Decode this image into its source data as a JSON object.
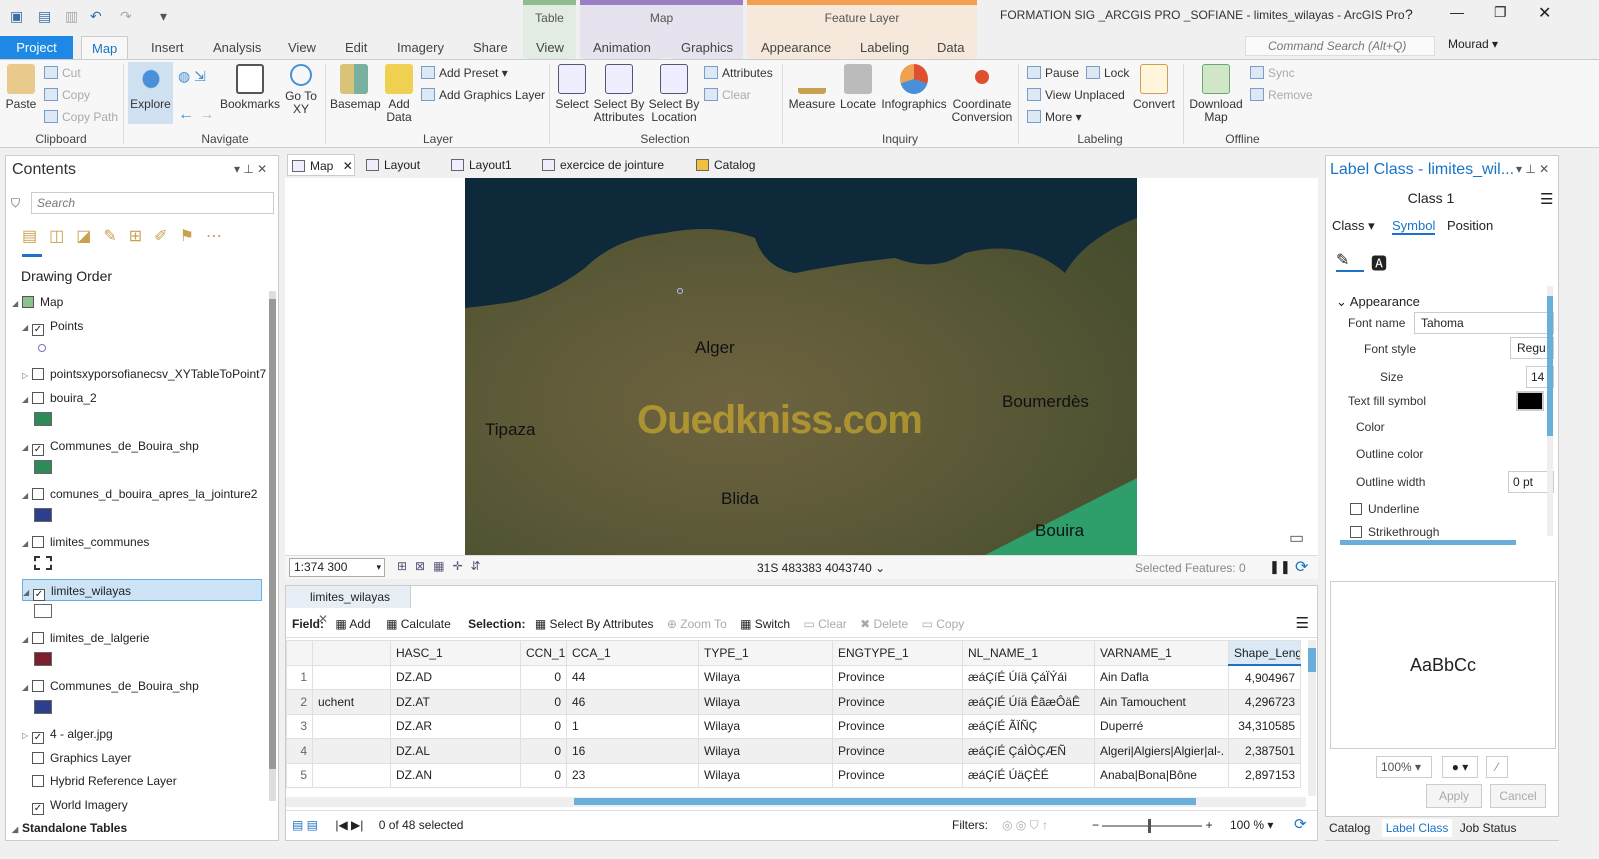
{
  "app": {
    "title": "FORMATION SIG _ARCGIS PRO _SOFIANE - limites_wilayas - ArcGIS Pro",
    "user": "Mourad",
    "command_search_placeholder": "Command Search (Alt+Q)"
  },
  "context_tabs": [
    {
      "group": "Table",
      "color": "#8fbc8f",
      "tabs": [
        "View"
      ]
    },
    {
      "group": "Map",
      "color": "#9b7fc4",
      "tabs": [
        "Animation",
        "Graphics"
      ]
    },
    {
      "group": "Feature Layer",
      "color": "#f0a050",
      "tabs": [
        "Appearance",
        "Labeling",
        "Data"
      ]
    }
  ],
  "ribbon_tabs": [
    "Project",
    "Map",
    "Insert",
    "Analysis",
    "View",
    "Edit",
    "Imagery",
    "Share"
  ],
  "active_tab": "Map",
  "ribbon": {
    "clipboard": {
      "label": "Clipboard",
      "paste": "Paste",
      "cut": "Cut",
      "copy": "Copy",
      "copy_path": "Copy Path"
    },
    "navigate": {
      "label": "Navigate",
      "explore": "Explore",
      "bookmarks": "Bookmarks",
      "goto": "Go To XY"
    },
    "layer": {
      "label": "Layer",
      "basemap": "Basemap",
      "add_data": "Add Data",
      "add_preset": "Add Preset",
      "add_graphics": "Add Graphics Layer"
    },
    "selection": {
      "label": "Selection",
      "select": "Select",
      "by_attr": "Select By Attributes",
      "by_loc": "Select By Location",
      "attributes": "Attributes",
      "clear": "Clear"
    },
    "inquiry": {
      "label": "Inquiry",
      "measure": "Measure",
      "locate": "Locate",
      "infographics": "Infographics",
      "coord": "Coordinate Conversion"
    },
    "labeling": {
      "label": "Labeling",
      "pause": "Pause",
      "lock": "Lock",
      "view_unplaced": "View Unplaced",
      "more": "More",
      "convert": "Convert"
    },
    "offline": {
      "label": "Offline",
      "download": "Download Map",
      "sync": "Sync",
      "remove": "Remove"
    }
  },
  "contents": {
    "title": "Contents",
    "search_placeholder": "Search",
    "drawing_order": "Drawing Order",
    "layers": [
      {
        "name": "Map",
        "checked": null
      },
      {
        "name": "Points",
        "checked": true
      },
      {
        "name": "pointsxyporsofianecsv_XYTableToPoint7",
        "checked": false
      },
      {
        "name": "bouira_2",
        "checked": false,
        "swatch": "#2e8b57"
      },
      {
        "name": "Communes_de_Bouira_shp",
        "checked": true,
        "swatch": "#2e8b57"
      },
      {
        "name": "comunes_d_bouira_apres_la_jointure2",
        "checked": false,
        "swatch": "#2b3f8c"
      },
      {
        "name": "limites_communes",
        "checked": false
      },
      {
        "name": "limites_wilayas",
        "checked": true,
        "selected": true
      },
      {
        "name": "limites_de_lalgerie",
        "checked": false,
        "swatch": "#7b1e2e"
      },
      {
        "name": "Communes_de_Bouira_shp",
        "checked": false,
        "swatch": "#2b3f8c"
      },
      {
        "name": "4 - alger.jpg",
        "checked": true
      },
      {
        "name": "Graphics Layer",
        "checked": false
      },
      {
        "name": "Hybrid Reference Layer",
        "checked": false
      },
      {
        "name": "World Imagery",
        "checked": true
      }
    ],
    "standalone": "Standalone Tables"
  },
  "view_tabs": [
    "Map",
    "Layout",
    "Layout1",
    "exercice de jointure",
    "Catalog"
  ],
  "map": {
    "labels": [
      "Alger",
      "Tipaza",
      "Boumerdès",
      "Blida",
      "Bouira"
    ],
    "watermark": "Ouedkniss.com",
    "scale": "1:374 300",
    "coords": "31S 483383 4043740",
    "selected_features": "Selected Features: 0"
  },
  "table": {
    "tab": "limites_wilayas",
    "field_label": "Field:",
    "add": "Add",
    "calculate": "Calculate",
    "selection_label": "Selection:",
    "select_by_attr": "Select By Attributes",
    "zoom_to": "Zoom To",
    "switch": "Switch",
    "clear": "Clear",
    "delete": "Delete",
    "copy": "Copy",
    "columns": [
      "",
      "HASC_1",
      "CCN_1",
      "CCA_1",
      "TYPE_1",
      "ENGTYPE_1",
      "NL_NAME_1",
      "VARNAME_1",
      "Shape_Leng"
    ],
    "rows": [
      [
        "1",
        "",
        "DZ.AD",
        "0",
        "44",
        "Wilaya",
        "Province",
        "æáÇíÉ Úíä ÇáÏÝáì",
        "Ain Dafla",
        "4,904967"
      ],
      [
        "2",
        "uchent",
        "DZ.AT",
        "0",
        "46",
        "Wilaya",
        "Province",
        "æáÇíÉ Úíä ÊãæÔäÊ",
        "Ain Tamouchent",
        "4,296723"
      ],
      [
        "3",
        "",
        "DZ.AR",
        "0",
        "1",
        "Wilaya",
        "Province",
        "æáÇíÉ ÃÏÑÇ",
        "Duperré",
        "34,310585"
      ],
      [
        "4",
        "",
        "DZ.AL",
        "0",
        "16",
        "Wilaya",
        "Province",
        "æáÇíÉ ÇáÌÒÇÆÑ",
        "Algeri|Algiers|Algier|al-.",
        "2,387501"
      ],
      [
        "5",
        "",
        "DZ.AN",
        "0",
        "23",
        "Wilaya",
        "Province",
        "æáÇíÉ ÚäÇÈÉ",
        "Anaba|Bona|Bône",
        "2,897153"
      ]
    ],
    "status": "0 of 48 selected",
    "filters": "Filters:",
    "zoom": "100 %"
  },
  "label_pane": {
    "title": "Label Class - limites_wil...",
    "class_name": "Class 1",
    "tabs": [
      "Class",
      "Symbol",
      "Position"
    ],
    "section": "Appearance",
    "font_name_label": "Font name",
    "font_name": "Tahoma",
    "font_style_label": "Font style",
    "font_style": "Regu",
    "size_label": "Size",
    "size": "14",
    "text_fill": "Text fill symbol",
    "color": "Color",
    "outline_color": "Outline color",
    "outline_width_label": "Outline width",
    "outline_width": "0 pt",
    "underline": "Underline",
    "strikethrough": "Strikethrough",
    "preview": "AaBbCc",
    "zoom": "100%",
    "apply": "Apply",
    "cancel": "Cancel",
    "bottom_tabs": [
      "Catalog",
      "Label Class",
      "Job Status"
    ]
  }
}
